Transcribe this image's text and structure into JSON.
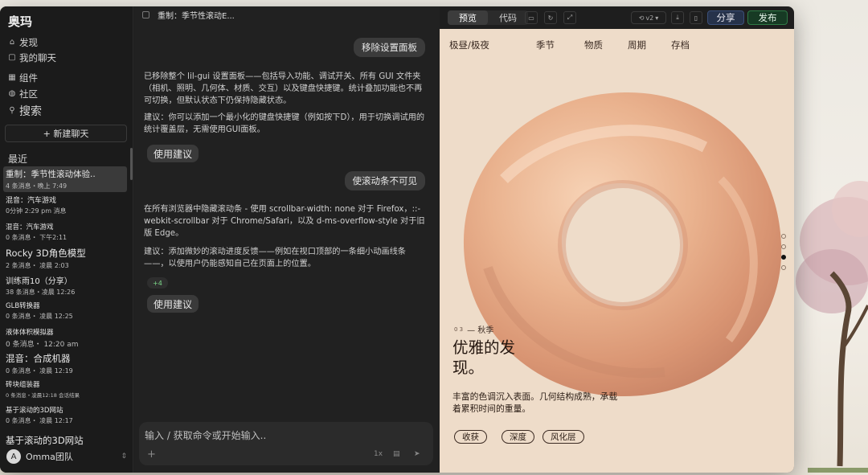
{
  "sidebar": {
    "brand": "奥玛",
    "nav": [
      {
        "label": "发现",
        "icon": "home-icon"
      },
      {
        "label": "我的聊天",
        "icon": "chat-icon"
      },
      {
        "label": "组件",
        "icon": "grid-icon"
      },
      {
        "label": "社区",
        "icon": "globe-icon"
      },
      {
        "label": "搜索",
        "icon": "search-icon"
      }
    ],
    "new_chat": "+ 新建聊天",
    "recent_heading": "最近",
    "history": [
      {
        "title": "重制：季节性滚动体验..",
        "meta": "4 条消息・晚上 7:49"
      },
      {
        "title": "混音：汽车游戏",
        "meta": "0分钟 2:29 pm 消息"
      },
      {
        "title": "混音：汽车游戏",
        "meta": "0 条消息・ 下午2:11"
      },
      {
        "title": "Rocky 3D角色模型",
        "meta": "2 条消息・ 凌晨 2:03"
      },
      {
        "title": "训练雨10（分享）",
        "meta": "38 条消息・凌晨 12:26"
      },
      {
        "title": "GLB转换器",
        "meta": "0 条消息・ 凌晨 12:25"
      },
      {
        "title": "液体体积模拟器",
        "meta": "0 条消息・ 12:20 am"
      },
      {
        "title": "混音：合成机器",
        "meta": "0 条消息・ 凌晨 12:19"
      },
      {
        "title": "砖块组装器",
        "meta": "0 条消息・凌晨12:18 会话结果"
      },
      {
        "title": "基于滚动的3D网站",
        "meta": "0 条消息・ 凌晨 12:17"
      },
      {
        "title": "基于滚动的3D网站",
        "meta": ""
      }
    ],
    "team": {
      "avatar": "A",
      "label": "Omma团队"
    }
  },
  "chat": {
    "title": "重制：季节性滚动E...",
    "user1": "移除设置面板",
    "reply1": "已移除整个 lil-gui 设置面板——包括导入功能、调试开关、所有 GUI 文件夹（相机、照明、几何体、材质、交互）以及键盘快捷键。统计叠加功能也不再可切换，但默认状态下仍保持隐藏状态。",
    "reply1b": "建议：你可以添加一个最小化的键盘快捷键（例如按下D），用于切换调试用的统计覆盖层，无需使用GUI面板。",
    "suggest1": "使用建议",
    "user2": "使滚动条不可见",
    "reply2": "在所有浏览器中隐藏滚动条 - 使用 scrollbar-width: none 对于 Firefox，::-webkit-scrollbar 对于 Chrome/Safari，以及 d-ms-overflow-style 对于旧版 Edge。",
    "reply2b": "建议：添加微妙的滚动进度反馈——例如在视口顶部的一条细小动画线条——，以使用户仍能感知自己在页面上的位置。",
    "badge": "+4",
    "suggest2": "使用建议",
    "composer_placeholder": "输入 / 获取命令或开始输入.."
  },
  "preview": {
    "tabs": [
      "预览",
      "代码"
    ],
    "version": "v2",
    "share": "分享",
    "publish": "发布",
    "nav": [
      "极昼/极夜",
      "季节",
      "物质",
      "周期",
      "存档"
    ],
    "section_num": "0 3",
    "section_label": "— 秋季",
    "headline": "优雅的发现。",
    "description": "丰富的色调沉入表面。几何结构成熟，承载着累积时间的重量。",
    "chips": [
      "收获",
      "深度",
      "风化层"
    ],
    "scroll_dots": 4,
    "active_dot": 2
  }
}
